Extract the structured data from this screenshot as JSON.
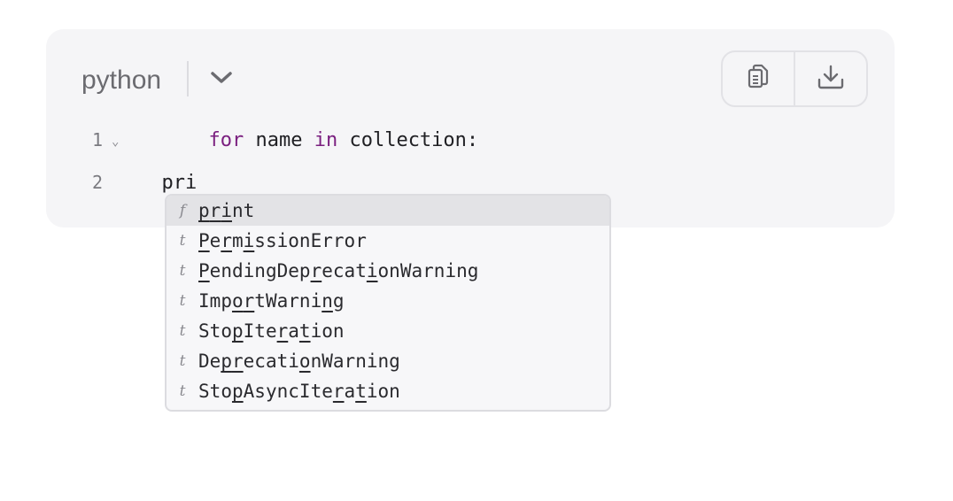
{
  "editor": {
    "language": "python",
    "copy_icon": "copy-icon",
    "download_icon": "download-icon",
    "dropdown_icon": "chevron-down-icon",
    "lines": [
      {
        "number": "1",
        "tokens": [
          {
            "text": "for",
            "kw": true
          },
          {
            "text": " name ",
            "kw": false
          },
          {
            "text": "in",
            "kw": true
          },
          {
            "text": " collection:",
            "kw": false
          }
        ]
      },
      {
        "number": "2",
        "tokens": [
          {
            "text": "  pri",
            "kw": false
          }
        ]
      }
    ]
  },
  "autocomplete": {
    "items": [
      {
        "kind": "f",
        "label": "print",
        "match": [
          0,
          1,
          2
        ],
        "selected": true
      },
      {
        "kind": "t",
        "label": "PermissionError",
        "match": [
          0,
          2,
          4
        ],
        "selected": false
      },
      {
        "kind": "t",
        "label": "PendingDeprecationWarning",
        "match": [
          0,
          10,
          15
        ],
        "selected": false
      },
      {
        "kind": "t",
        "label": "ImportWarning",
        "match": [
          3,
          4,
          11
        ],
        "selected": false
      },
      {
        "kind": "t",
        "label": "StopIteration",
        "match": [
          3,
          7,
          9
        ],
        "selected": false
      },
      {
        "kind": "t",
        "label": "DeprecationWarning",
        "match": [
          2,
          3,
          9
        ],
        "selected": false
      },
      {
        "kind": "t",
        "label": "StopAsyncIteration",
        "match": [
          3,
          12,
          14
        ],
        "selected": false
      }
    ]
  },
  "colors": {
    "keyword": "#7a1f7f",
    "panel_bg": "#f5f5f7",
    "selected_bg": "#e3e3e6"
  }
}
